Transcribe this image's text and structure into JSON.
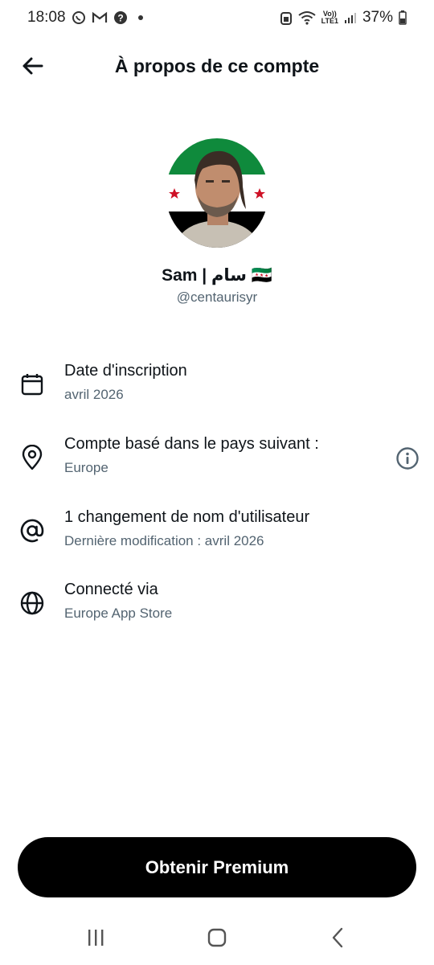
{
  "status_bar": {
    "time": "18:08",
    "lte_top": "Vo))",
    "lte_bottom": "LTE1",
    "battery": "37%"
  },
  "header": {
    "title": "À propos de ce compte"
  },
  "profile": {
    "name": "Sam | سام 🇸🇾",
    "handle": "@centaurisyr"
  },
  "rows": [
    {
      "icon": "calendar-icon",
      "label": "Date d'inscription",
      "sub": "avril 2026"
    },
    {
      "icon": "location-pin-icon",
      "label": "Compte basé dans le pays suivant :",
      "sub": "Europe"
    },
    {
      "icon": "at-sign-icon",
      "label": "1 changement de nom d'utilisateur",
      "sub": "Dernière modification : avril 2026"
    },
    {
      "icon": "globe-icon",
      "label": "Connecté via",
      "sub": "Europe App Store"
    }
  ],
  "premium_button": "Obtenir Premium",
  "colors": {
    "text_primary": "#0f1419",
    "text_secondary": "#536471",
    "button_bg": "#000000",
    "button_text": "#ffffff"
  }
}
